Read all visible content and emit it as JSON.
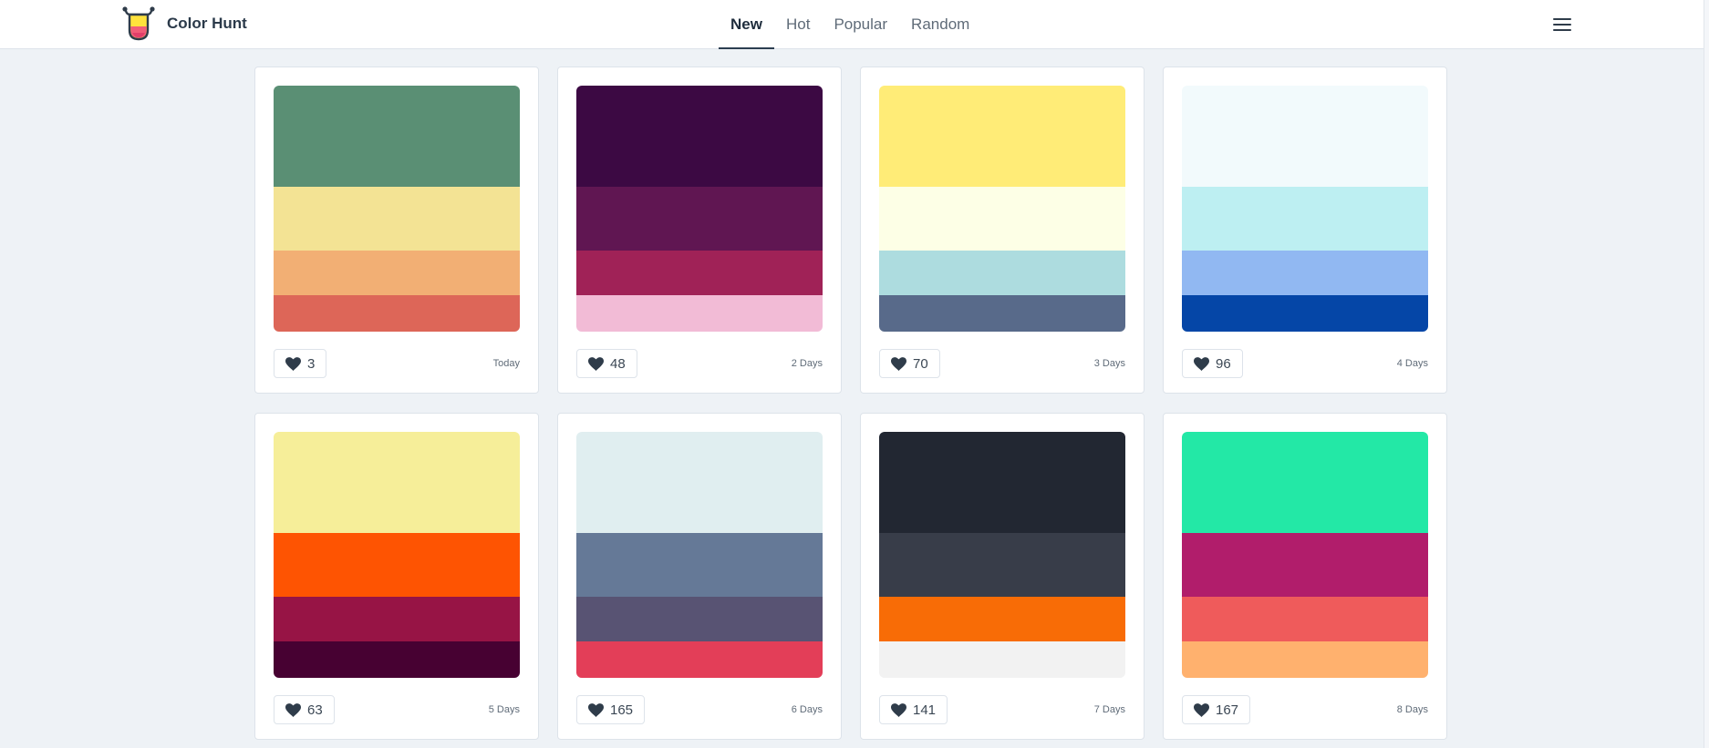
{
  "header": {
    "brand_name": "Color Hunt",
    "tabs": [
      {
        "label": "New",
        "active": true
      },
      {
        "label": "Hot",
        "active": false
      },
      {
        "label": "Popular",
        "active": false
      },
      {
        "label": "Random",
        "active": false
      }
    ],
    "menu_icon": "hamburger-menu-icon",
    "logo_icon": "color-hunt-logo-icon"
  },
  "like_icon": "heart-icon",
  "palettes": [
    {
      "colors": [
        "#5a8f74",
        "#f3e394",
        "#f2af74",
        "#dd6658"
      ],
      "likes": "3",
      "date": "Today"
    },
    {
      "colors": [
        "#3c0943",
        "#601652",
        "#a02257",
        "#f2bbd6"
      ],
      "likes": "48",
      "date": "2 Days"
    },
    {
      "colors": [
        "#ffec77",
        "#fdffe6",
        "#addcdf",
        "#586a8a"
      ],
      "likes": "70",
      "date": "3 Days"
    },
    {
      "colors": [
        "#f2fafc",
        "#bdeff2",
        "#91b8f2",
        "#0546a7"
      ],
      "likes": "96",
      "date": "4 Days"
    },
    {
      "colors": [
        "#f6ee99",
        "#fe5402",
        "#971445",
        "#470132"
      ],
      "likes": "63",
      "date": "5 Days"
    },
    {
      "colors": [
        "#e0eef0",
        "#657997",
        "#585373",
        "#e33e58"
      ],
      "likes": "165",
      "date": "6 Days"
    },
    {
      "colors": [
        "#222732",
        "#383d49",
        "#f86c06",
        "#f2f2f2"
      ],
      "likes": "141",
      "date": "7 Days"
    },
    {
      "colors": [
        "#23e8a6",
        "#b11d6b",
        "#ef5b5b",
        "#ffb16e"
      ],
      "likes": "167",
      "date": "8 Days"
    }
  ],
  "colors": {
    "background": "#eef2f6",
    "header_bg": "#ffffff",
    "active_underline": "#2c3e50",
    "heart": "#2f3c4a"
  }
}
